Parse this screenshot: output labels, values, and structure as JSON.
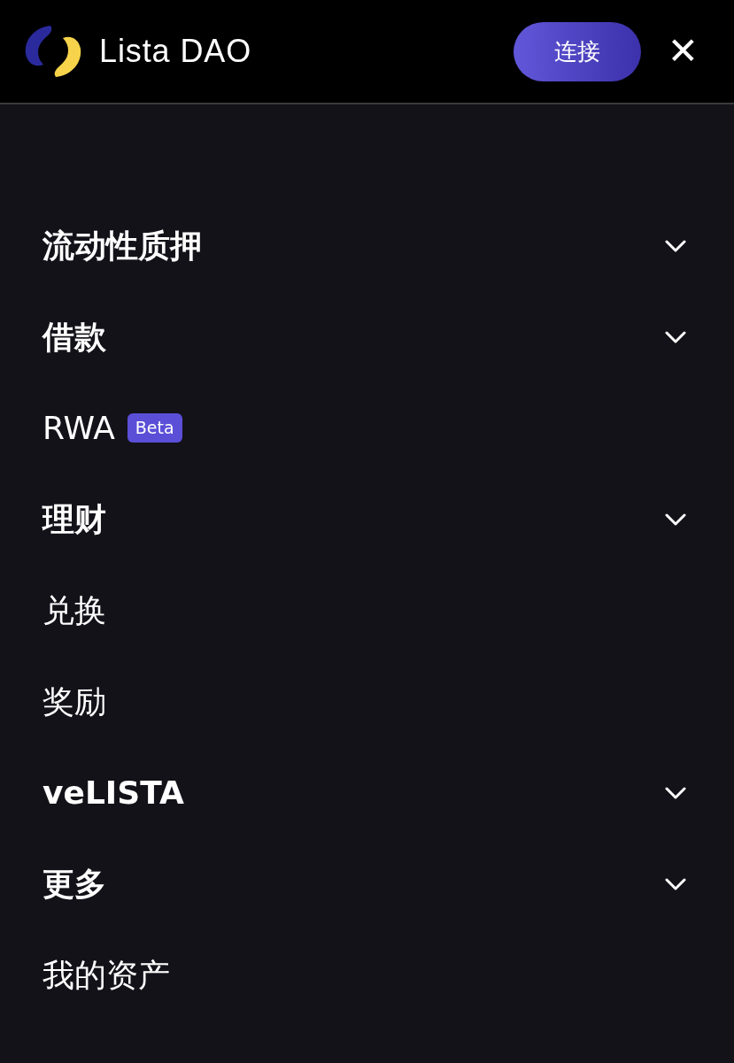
{
  "header": {
    "brand": "Lista DAO",
    "connect_button": "连接",
    "close": "✕"
  },
  "menu": [
    {
      "label": "流动性质押",
      "expandable": true
    },
    {
      "label": "借款",
      "expandable": true
    },
    {
      "label": "RWA",
      "expandable": false,
      "badge": "Beta"
    },
    {
      "label": "理财",
      "expandable": true
    },
    {
      "label": "兑换",
      "expandable": false
    },
    {
      "label": "奖励",
      "expandable": false
    },
    {
      "label": "veLISTA",
      "expandable": true
    },
    {
      "label": "更多",
      "expandable": true
    },
    {
      "label": "我的资产",
      "expandable": false
    }
  ]
}
